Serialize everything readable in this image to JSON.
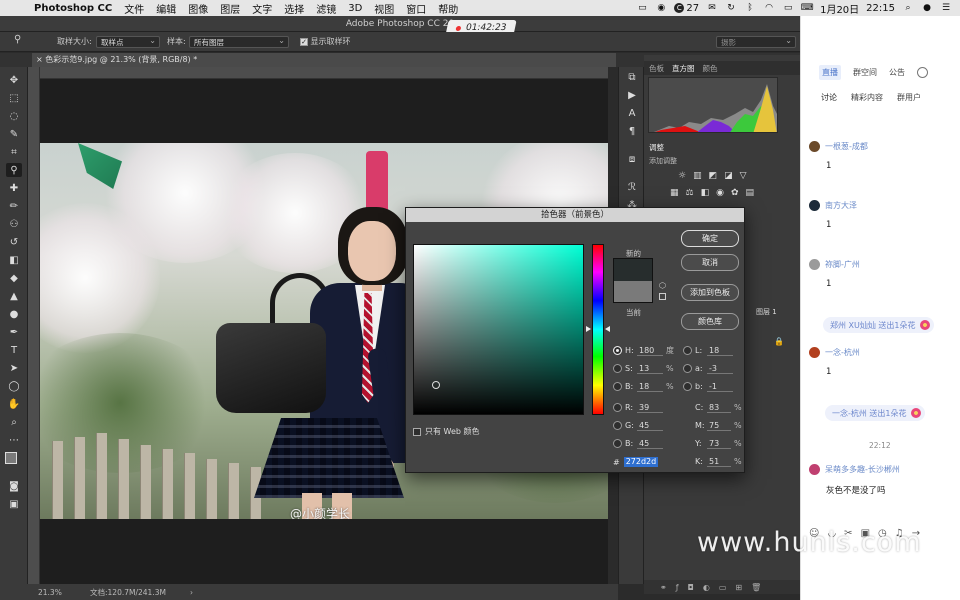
{
  "menubar": {
    "app_name": "Photoshop CC",
    "items": [
      "文件",
      "编辑",
      "图像",
      "图层",
      "文字",
      "选择",
      "滤镜",
      "3D",
      "视图",
      "窗口",
      "帮助"
    ],
    "badge_count": "27",
    "date": "1月20日",
    "time": "22:15"
  },
  "window": {
    "title": "Adobe Photoshop CC 20"
  },
  "recording": {
    "elapsed": "01:42:23"
  },
  "options_bar": {
    "sample_size_label": "取样大小:",
    "sample_size_value": "取样点",
    "sample_label": "样本:",
    "sample_value": "所有图层",
    "show_ring_label": "显示取样环",
    "workspace": "摄影"
  },
  "document": {
    "tab_title": "色彩示范9.jpg @ 21.3% (背景, RGB/8) *",
    "watermark": "@小颜学长"
  },
  "status_bar": {
    "zoom": "21.3%",
    "doc_size": "文档:120.7M/241.3M"
  },
  "color_picker": {
    "title": "拾色器（前景色）",
    "new_label": "新的",
    "current_label": "当前",
    "new_color": "#272d2d",
    "current_color": "#7a7a7a",
    "buttons": {
      "ok": "确定",
      "cancel": "取消",
      "add_swatch": "添加到色板",
      "libraries": "颜色库"
    },
    "web_only_label": "只有 Web 颜色",
    "hsb": [
      {
        "label": "H:",
        "value": "180",
        "unit": "度",
        "selected": true
      },
      {
        "label": "S:",
        "value": "13",
        "unit": "%",
        "selected": false
      },
      {
        "label": "B:",
        "value": "18",
        "unit": "%",
        "selected": false
      }
    ],
    "rgb": [
      {
        "label": "R:",
        "value": "39"
      },
      {
        "label": "G:",
        "value": "45"
      },
      {
        "label": "B:",
        "value": "45"
      }
    ],
    "lab": [
      {
        "label": "L:",
        "value": "18"
      },
      {
        "label": "a:",
        "value": "-3"
      },
      {
        "label": "b:",
        "value": "-1"
      }
    ],
    "cmyk": [
      {
        "label": "C:",
        "value": "83",
        "unit": "%"
      },
      {
        "label": "M:",
        "value": "75",
        "unit": "%"
      },
      {
        "label": "Y:",
        "value": "73",
        "unit": "%"
      },
      {
        "label": "K:",
        "value": "51",
        "unit": "%"
      }
    ],
    "hex_prefix": "#",
    "hex": "272d2d"
  },
  "panels": {
    "top_tabs": [
      "色板",
      "直方图",
      "颜色"
    ],
    "active_top_tab": "直方图",
    "adjust_title": "调整",
    "adjust_sub": "添加调整",
    "layer_name": "图层 1"
  },
  "chat": {
    "tabs": [
      "直播",
      "群空间",
      "公告"
    ],
    "active_tab": "直播",
    "subtabs": [
      "讨论",
      "精彩内容",
      "群用户"
    ],
    "messages": [
      {
        "user": "一根葱-成都",
        "text": "1",
        "avatar_color": "#6b4a2a"
      },
      {
        "user": "南方大泽",
        "text": "1",
        "avatar_color": "#1d2b3a"
      },
      {
        "user": "祢脚-广州",
        "text": "1",
        "avatar_color": "#9a9a9a"
      },
      {
        "user": "一念-杭州",
        "text": "1",
        "avatar_color": "#b2401f"
      },
      {
        "user": "呆萌多多趣-长沙郴州",
        "text": "灰色不是没了吗",
        "avatar_color": "#c04070"
      }
    ],
    "gifts": [
      "郑州 XU灿灿 送出1朵花",
      "一念-杭州 送出1朵花"
    ],
    "time_marker": "22:12"
  },
  "site_watermark": "www.hunls.com"
}
